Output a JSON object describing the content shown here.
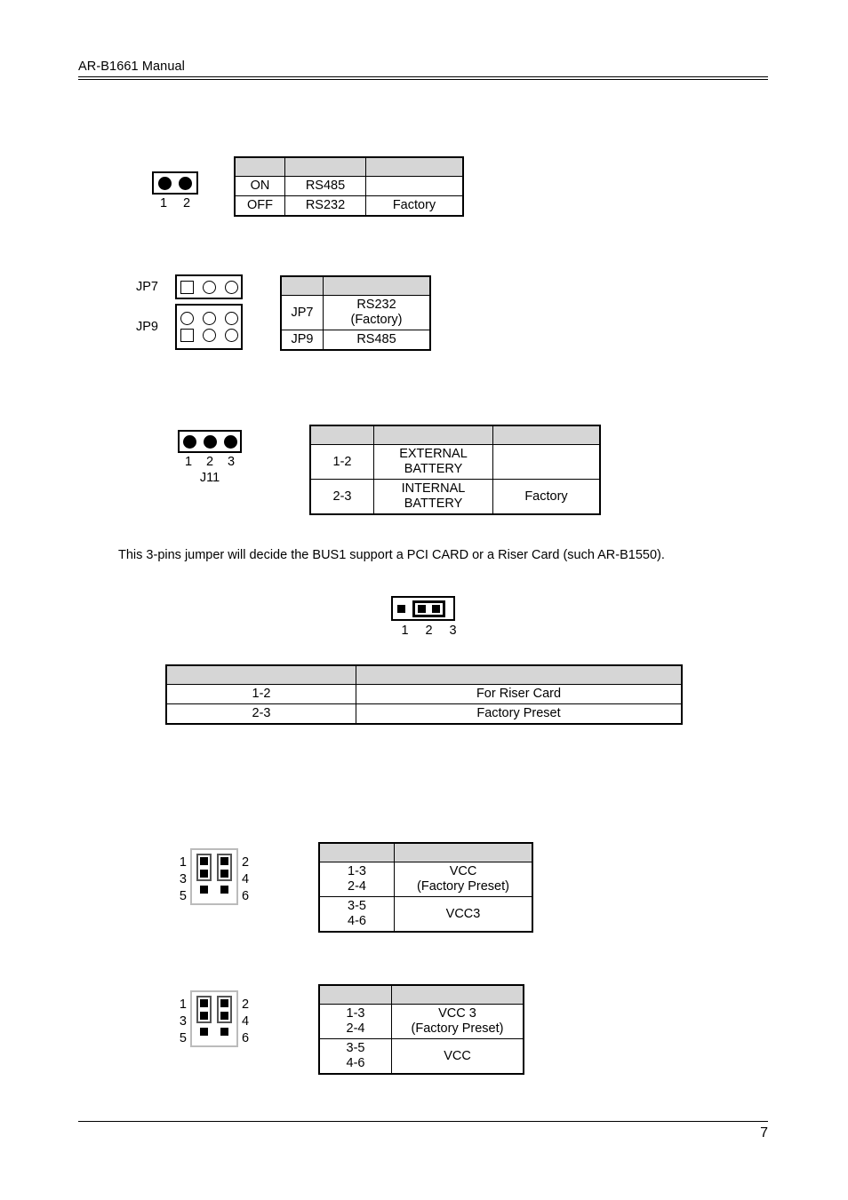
{
  "document": {
    "header_title": "AR-B1661 Manual",
    "page_number": "7"
  },
  "sections": [
    {
      "id": "rs485-switch",
      "diagram": {
        "pin_labels": [
          "1",
          "2"
        ],
        "pin_states": [
          "filled",
          "filled"
        ]
      },
      "table": {
        "header": [
          "",
          "",
          ""
        ],
        "rows": [
          [
            "ON",
            "RS485",
            ""
          ],
          [
            "OFF",
            "RS232",
            "Factory"
          ]
        ]
      }
    },
    {
      "id": "jp7-jp9",
      "diagram": {
        "row_labels": [
          "JP7",
          "JP9"
        ],
        "jp7_pins": [
          "square",
          "ring",
          "ring"
        ],
        "jp9_top_pins": [
          "ring",
          "ring",
          "ring"
        ],
        "jp9_bottom_pins": [
          "square",
          "ring",
          "ring"
        ]
      },
      "table": {
        "header": [
          "",
          ""
        ],
        "rows": [
          [
            "JP7",
            "RS232\n(Factory)"
          ],
          [
            "JP9",
            "RS485"
          ]
        ],
        "jp7_line1": "RS232",
        "jp7_line2": "(Factory)",
        "jp9_value": "RS485",
        "jp7_label": "JP7",
        "jp9_label": "JP9"
      }
    },
    {
      "id": "j11-battery",
      "diagram": {
        "pin_labels": [
          "1",
          "2",
          "3"
        ],
        "pin_states": [
          "filled",
          "filled",
          "filled"
        ],
        "connector_name": "J11"
      },
      "table": {
        "header": [
          "",
          "",
          ""
        ],
        "rows": [
          [
            "1-2",
            "EXTERNAL\nBATTERY",
            ""
          ],
          [
            "2-3",
            "INTERNAL\nBATTERY",
            "Factory"
          ]
        ],
        "row1_pins": "1-2",
        "row1_line1": "EXTERNAL",
        "row1_line2": "BATTERY",
        "row1_note": "",
        "row2_pins": "2-3",
        "row2_line1": "INTERNAL",
        "row2_line2": "BATTERY",
        "row2_note": "Factory"
      }
    },
    {
      "id": "bus1-riser",
      "description": "This 3-pins jumper will decide the BUS1 support a PCI CARD or a Riser Card (such AR-B1550).",
      "diagram": {
        "pin_labels": [
          "1",
          "2",
          "3"
        ],
        "shorted": "2-3"
      },
      "table": {
        "header": [
          "",
          ""
        ],
        "rows": [
          [
            "1-2",
            "For Riser Card"
          ],
          [
            "2-3",
            "Factory Preset"
          ]
        ]
      }
    },
    {
      "id": "vcc-select-1",
      "diagram": {
        "left_labels": [
          "1",
          "3",
          "5"
        ],
        "right_labels": [
          "2",
          "4",
          "6"
        ],
        "capped_pins": [
          "1-3",
          "2-4"
        ]
      },
      "table": {
        "header": [
          "",
          ""
        ],
        "rows": [
          [
            "1-3\n2-4",
            "VCC\n(Factory Preset)"
          ],
          [
            "3-5\n4-6",
            "VCC3"
          ]
        ],
        "row1_pins_line1": "1-3",
        "row1_pins_line2": "2-4",
        "row1_value_line1": "VCC",
        "row1_value_line2": "(Factory Preset)",
        "row2_pins_line1": "3-5",
        "row2_pins_line2": "4-6",
        "row2_value": "VCC3"
      }
    },
    {
      "id": "vcc-select-2",
      "diagram": {
        "left_labels": [
          "1",
          "3",
          "5"
        ],
        "right_labels": [
          "2",
          "4",
          "6"
        ],
        "capped_pins": [
          "1-3",
          "2-4"
        ]
      },
      "table": {
        "header": [
          "",
          ""
        ],
        "rows": [
          [
            "1-3\n2-4",
            "VCC 3\n(Factory Preset)"
          ],
          [
            "3-5\n4-6",
            "VCC"
          ]
        ],
        "row1_pins_line1": "1-3",
        "row1_pins_line2": "2-4",
        "row1_value_line1": "VCC 3",
        "row1_value_line2": "(Factory Preset)",
        "row2_pins_line1": "3-5",
        "row2_pins_line2": "4-6",
        "row2_value": "VCC"
      }
    }
  ],
  "colors": {
    "table_header_gray": "#d6d6d6",
    "ink": "#000000",
    "paper": "#ffffff"
  }
}
